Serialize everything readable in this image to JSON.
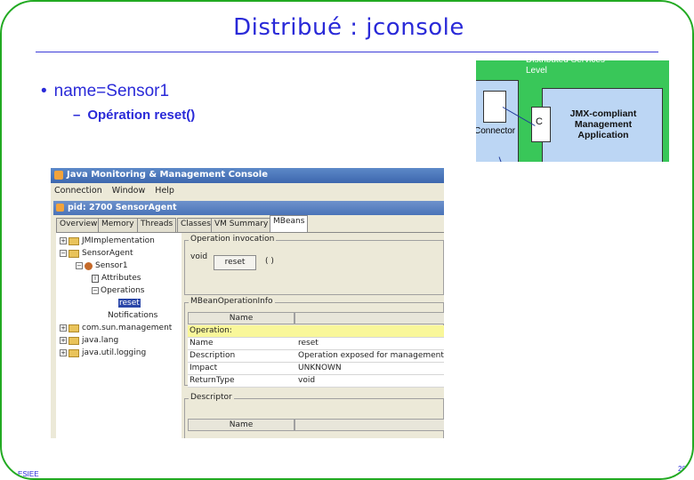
{
  "slide": {
    "title": "Distribué : jconsole",
    "bullet1": "name=Sensor1",
    "bullet2": "Opération reset()",
    "bullet_mark": "•",
    "dash_mark": "–",
    "footer_left": "ESIEE",
    "page_number": "20"
  },
  "diagram": {
    "top_label": "Distributed Services\nLevel",
    "left_label": "Connector",
    "c_label": "C",
    "app_label": "JMX-compliant\nManagement\nApplication"
  },
  "window": {
    "title": "Java Monitoring & Management Console",
    "menu": [
      "Connection",
      "Window",
      "Help"
    ],
    "inner_title": "pid: 2700 SensorAgent",
    "tabs": [
      "Overview",
      "Memory",
      "Threads",
      "Classes",
      "VM Summary",
      "MBeans"
    ],
    "active_tab": "MBeans"
  },
  "tree": {
    "items": [
      {
        "label": "JMImplementation",
        "expander": "+"
      },
      {
        "label": "SensorAgent",
        "expander": "−"
      },
      {
        "label": "Sensor1",
        "expander": "−"
      },
      {
        "label": "Attributes",
        "leaf": "I"
      },
      {
        "label": "Operations",
        "expander": "−"
      },
      {
        "label": "reset"
      },
      {
        "label": "Notifications"
      },
      {
        "label": "com.sun.management",
        "expander": "+"
      },
      {
        "label": "java.lang",
        "expander": "+"
      },
      {
        "label": "java.util.logging",
        "expander": "+"
      }
    ]
  },
  "operation_invocation": {
    "title": "Operation invocation",
    "return_type": "void",
    "button": "reset",
    "params": "( )"
  },
  "mbean_info": {
    "title": "MBeanOperationInfo",
    "header": "Name",
    "rows": [
      {
        "name": "Operation:",
        "value": ""
      },
      {
        "name": "Name",
        "value": "reset"
      },
      {
        "name": "Description",
        "value": "Operation exposed for management"
      },
      {
        "name": "Impact",
        "value": "UNKNOWN"
      },
      {
        "name": "ReturnType",
        "value": "void"
      }
    ]
  },
  "descriptor": {
    "title": "Descriptor",
    "header": "Name"
  }
}
